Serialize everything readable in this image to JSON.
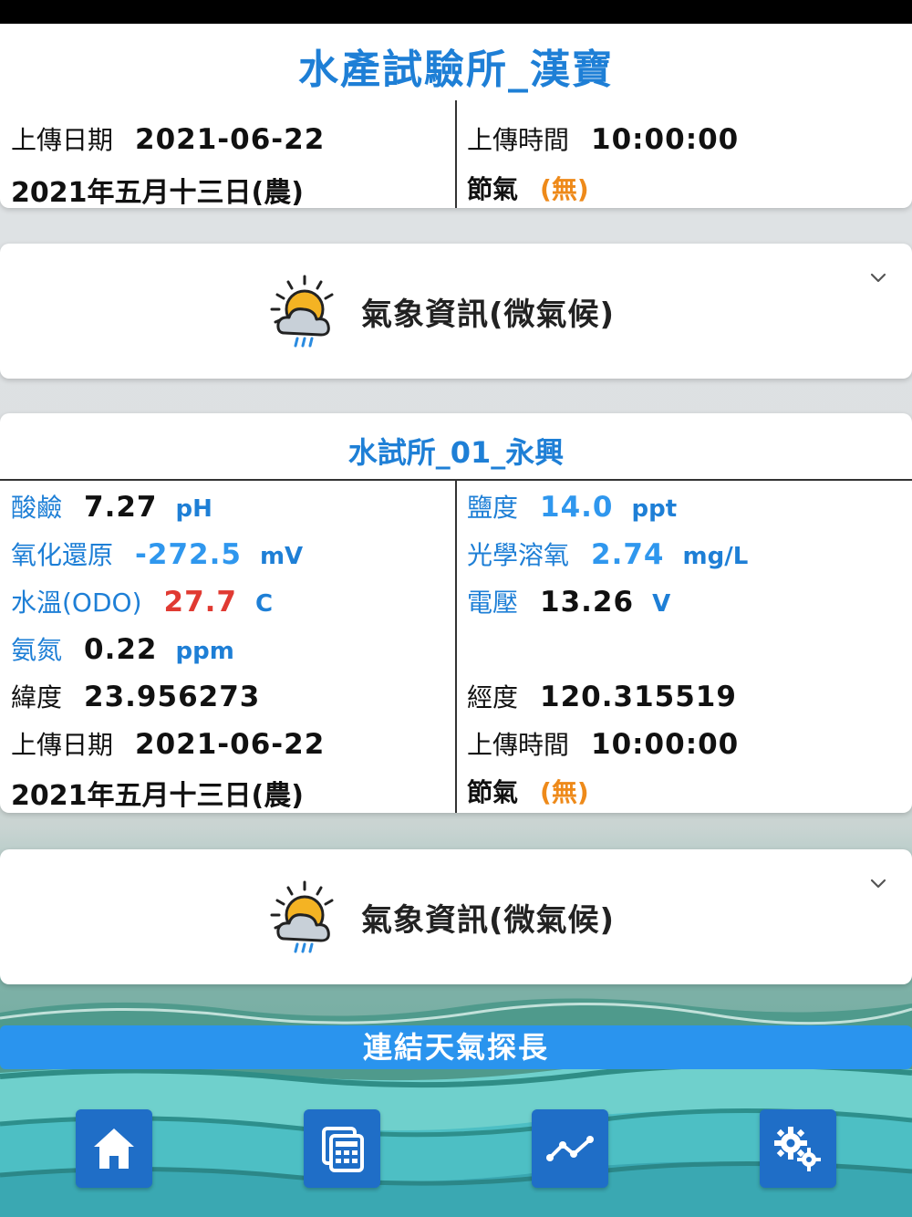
{
  "header": {
    "title": "水產試驗所_漢寶",
    "upload_date_label": "上傳日期",
    "upload_date": "2021-06-22",
    "upload_time_label": "上傳時間",
    "upload_time": "10:00:00",
    "lunar_date": "2021年五月十三日(農)",
    "jieqi_label": "節氣",
    "jieqi_value": "(無)"
  },
  "weather_card_1": {
    "label": "氣象資訊(微氣候)",
    "icon": "weather-sun-rain-icon"
  },
  "station": {
    "title": "水試所_01_永興",
    "ph": {
      "label": "酸鹼",
      "value": "7.27",
      "unit": "pH"
    },
    "salinity": {
      "label": "鹽度",
      "value": "14.0",
      "unit": "ppt"
    },
    "orp": {
      "label": "氧化還原",
      "value": "-272.5",
      "unit": "mV"
    },
    "do": {
      "label": "光學溶氧",
      "value": "2.74",
      "unit": "mg/L"
    },
    "temp": {
      "label": "水溫(ODO)",
      "value": "27.7",
      "unit": "C"
    },
    "voltage": {
      "label": "電壓",
      "value": "13.26",
      "unit": "V"
    },
    "ammonia": {
      "label": "氨氮",
      "value": "0.22",
      "unit": "ppm"
    },
    "latitude": {
      "label": "緯度",
      "value": "23.956273"
    },
    "longitude": {
      "label": "經度",
      "value": "120.315519"
    },
    "upload_date_label": "上傳日期",
    "upload_date": "2021-06-22",
    "upload_time_label": "上傳時間",
    "upload_time": "10:00:00",
    "lunar_date": "2021年五月十三日(農)",
    "jieqi_label": "節氣",
    "jieqi_value": "(無)"
  },
  "weather_card_2": {
    "label": "氣象資訊(微氣候)",
    "icon": "weather-sun-rain-icon"
  },
  "link_button": {
    "label": "連結天氣探長"
  },
  "nav": [
    {
      "name": "home",
      "icon": "home-icon"
    },
    {
      "name": "calendar",
      "icon": "calendar-grid-icon"
    },
    {
      "name": "chart",
      "icon": "line-chart-icon"
    },
    {
      "name": "settings",
      "icon": "gears-icon"
    }
  ],
  "colors": {
    "accent": "#1e7fd6",
    "value_blue": "#2f97ee",
    "value_red": "#e03a32",
    "jieqi_orange": "#ee8a1a",
    "nav_button": "#1f6ec7",
    "link_bar": "#2a94ee"
  }
}
